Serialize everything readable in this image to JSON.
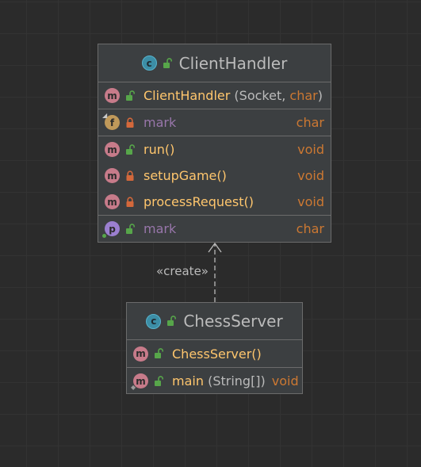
{
  "diagram": {
    "relation_label": "«create»",
    "classes": [
      {
        "name": "ClientHandler",
        "icon": "class-icon",
        "constructor": {
          "name": "ClientHandler",
          "open_paren": " (",
          "param1": "Socket, ",
          "param2": "char",
          "close_paren": ")"
        },
        "fields": [
          {
            "name": "mark",
            "type": "char",
            "visibility": "private"
          }
        ],
        "methods": [
          {
            "name": "run()",
            "type": "void",
            "visibility": "public"
          },
          {
            "name": "setupGame()",
            "type": "void",
            "visibility": "private"
          },
          {
            "name": "processRequest()",
            "type": "void",
            "visibility": "private"
          }
        ],
        "properties": [
          {
            "name": "mark",
            "type": "char",
            "visibility": "public"
          }
        ]
      },
      {
        "name": "ChessServer",
        "icon": "runnable-class-icon",
        "constructor": {
          "name": "ChessServer()"
        },
        "methods": [
          {
            "name": "main",
            "open_paren": " (",
            "param": "String[]",
            "close_paren": ")",
            "type": "void",
            "visibility": "public"
          }
        ]
      }
    ]
  },
  "colors": {
    "background": "#2b2b2b",
    "box": "#3c3f41",
    "border": "#6b6b6b",
    "method": "#ffc66d",
    "field": "#9876aa",
    "keyword": "#cc7832",
    "text": "#bbbbbb",
    "public_lock": "#57a64a",
    "private_lock": "#d4683b"
  }
}
